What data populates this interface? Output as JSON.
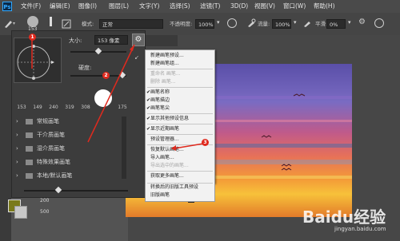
{
  "menubar": {
    "logo": "Ps",
    "items": [
      "文件(F)",
      "编辑(E)",
      "图像(I)",
      "图层(L)",
      "文字(Y)",
      "选择(S)",
      "滤镜(T)",
      "3D(D)",
      "视图(V)",
      "窗口(W)",
      "帮助(H)"
    ]
  },
  "options": {
    "brush_size": "153",
    "mode_label": "模式:",
    "mode_value": "正常",
    "opacity_label": "不透明度:",
    "opacity_value": "100%",
    "flow_label": "流量:",
    "flow_value": "100%",
    "smoothing_label": "平滑:",
    "smoothing_value": "0%"
  },
  "panel": {
    "size_label": "大小:",
    "size_value": "153 像素",
    "hardness_label": "硬度:",
    "preset_sizes": [
      "153",
      "149",
      "240",
      "319",
      "308",
      "",
      "175"
    ],
    "folders": [
      "常规画笔",
      "干介质画笔",
      "湿介质画笔",
      "特殊效果画笔",
      "本地/默认画笔"
    ]
  },
  "menu": {
    "items": [
      {
        "label": "新建画笔预设...",
        "disabled": false,
        "checked": false
      },
      {
        "label": "新建画笔组...",
        "disabled": false,
        "checked": false
      },
      {
        "label": "重命名 画笔...",
        "disabled": true,
        "checked": false
      },
      {
        "label": "删除 画笔...",
        "disabled": true,
        "checked": false
      },
      {
        "label": "画笔名称",
        "disabled": false,
        "checked": true
      },
      {
        "label": "画笔描边",
        "disabled": false,
        "checked": true
      },
      {
        "label": "画笔笔尖",
        "disabled": false,
        "checked": true
      },
      {
        "label": "显示其他预设信息",
        "disabled": false,
        "checked": true
      },
      {
        "label": "显示近期画笔",
        "disabled": false,
        "checked": true
      },
      {
        "label": "预设管理器...",
        "disabled": false,
        "checked": false
      },
      {
        "label": "恢复默认画笔...",
        "disabled": false,
        "checked": false
      },
      {
        "label": "导入画笔...",
        "disabled": false,
        "checked": false
      },
      {
        "label": "导出选中的画笔...",
        "disabled": true,
        "checked": false
      },
      {
        "label": "获取更多画笔...",
        "disabled": false,
        "checked": false
      },
      {
        "label": "转换后的旧版工具预设",
        "disabled": false,
        "checked": false
      },
      {
        "label": "旧版画笔",
        "disabled": false,
        "checked": false
      }
    ]
  },
  "annotations": {
    "badge1": "1",
    "badge2": "2",
    "badge3": "3"
  },
  "colors": {
    "accent_red": "#e02a1e",
    "foreground_swatch": "#7a7a1a",
    "sun": "#ffd21e"
  },
  "watermark": {
    "text": "Baidu经验",
    "url": "jingyan.baidu.com"
  },
  "left_numbers": {
    "a": "200",
    "b": "500"
  }
}
